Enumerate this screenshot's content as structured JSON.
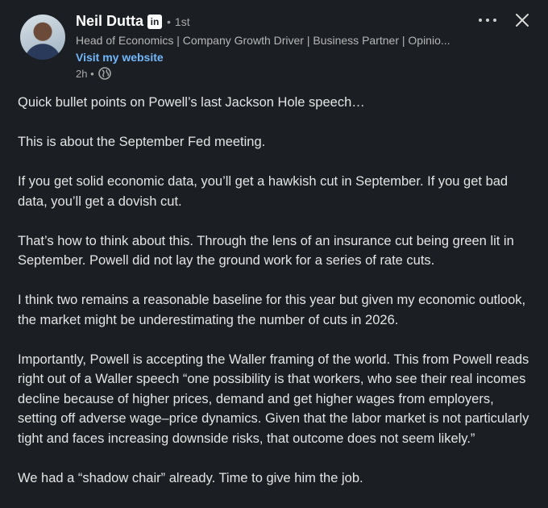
{
  "author": {
    "name": "Neil Dutta",
    "badge": "in",
    "separator": "•",
    "degree": "1st",
    "headline": "Head of Economics | Company Growth Driver | Business Partner | Opinio...",
    "website_label": "Visit my website",
    "time": "2h •"
  },
  "icons": {
    "more": "more-horizontal-icon",
    "close": "close-icon",
    "visibility": "globe-icon"
  },
  "post": {
    "paragraphs": [
      "Quick bullet points on Powell’s last Jackson Hole speech…",
      "This is about the September Fed meeting.",
      "If you get solid economic data, you’ll get a hawkish cut in September. If you get bad data, you’ll get a dovish cut.",
      "That’s how to think about this. Through the lens of an insurance cut being green lit in September. Powell did not lay the ground work for a series of rate cuts.",
      "I think two remains a reasonable baseline for this year but given my economic outlook, the market might be underestimating the number of cuts in 2026.",
      "Importantly, Powell is accepting the Waller framing of the world. This from Powell reads right out of a Waller speech “one possibility is that workers, who see their real incomes decline because of higher prices, demand and get higher wages from employers, setting off adverse wage–price dynamics. Given that the labor market is not particularly tight and faces increasing downside risks, that outcome does not seem likely.”",
      "We had a “shadow chair” already. Time to give him the job."
    ]
  },
  "colors": {
    "background": "#1b1f23",
    "link": "#71b7fb",
    "text": "#e4e4e4"
  }
}
